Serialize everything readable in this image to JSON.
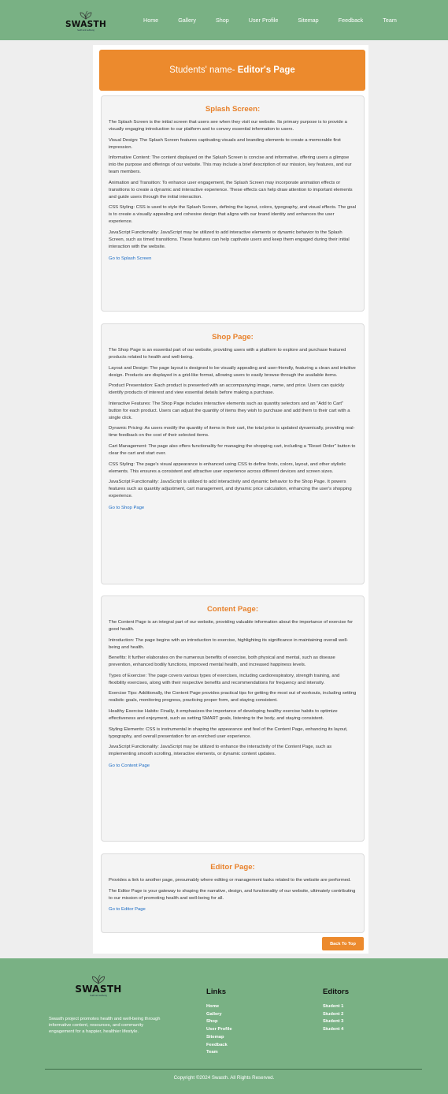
{
  "nav": {
    "logo_text": "SWASTH",
    "logo_tagline": "health and wellbeing",
    "links": [
      "Home",
      "Gallery",
      "Shop",
      "User Profile",
      "Sitemap",
      "Feedback",
      "Team"
    ]
  },
  "header": {
    "prefix": "Students' name- ",
    "title": "Editor's Page"
  },
  "sections": [
    {
      "title": "Splash Screen:",
      "paragraphs": [
        "The Splash Screen is the initial screen that users see when they visit our website. Its primary purpose is to provide a visually engaging introduction to our platform and to convey essential information to users.",
        "Visual Design: The Splash Screen features captivating visuals and branding elements to create a memorable first impression.",
        "Informative Content: The content displayed on the Splash Screen is concise and informative, offering users a glimpse into the purpose and offerings of our website. This may include a brief description of our mission, key features, and our team members.",
        "Animation and Transition: To enhance user engagement, the Splash Screen may incorporate animation effects or transitions to create a dynamic and interactive experience. These effects can help draw attention to important elements and guide users through the initial interaction.",
        "CSS Styling: CSS is used to style the Splash Screen, defining the layout, colors, typography, and visual effects. The goal is to create a visually appealing and cohesive design that aligns with our brand identity and enhances the user experience.",
        "JavaScript Functionality: JavaScript may be utilized to add interactive elements or dynamic behavior to the Splash Screen, such as timed transitions. These features can help captivate users and keep them engaged during their initial interaction with the website."
      ],
      "link": "Go to Splash Screen"
    },
    {
      "title": "Shop Page:",
      "paragraphs": [
        "The Shop Page is an essential part of our website, providing users with a platform to explore and purchase featured products related to health and well-being.",
        "Layout and Design: The page layout is designed to be visually appealing and user-friendly, featuring a clean and intuitive design. Products are displayed in a grid-like format, allowing users to easily browse through the available items.",
        "Product Presentation: Each product is presented with an accompanying image, name, and price. Users can quickly identify products of interest and view essential details before making a purchase.",
        "Interactive Features: The Shop Page includes interactive elements such as quantity selectors and an \"Add to Cart\" button for each product. Users can adjust the quantity of items they wish to purchase and add them to their cart with a single click.",
        "Dynamic Pricing: As users modify the quantity of items in their cart, the total price is updated dynamically, providing real-time feedback on the cost of their selected items.",
        "Cart Management: The page also offers functionality for managing the shopping cart, including a \"Reset Order\" button to clear the cart and start over.",
        "CSS Styling: The page's visual appearance is enhanced using CSS to define fonts, colors, layout, and other stylistic elements. This ensures a consistent and attractive user experience across different devices and screen sizes.",
        "JavaScript Functionality: JavaScript is utilized to add interactivity and dynamic behavior to the Shop Page. It powers features such as quantity adjustment, cart management, and dynamic price calculation, enhancing the user's shopping experience."
      ],
      "link": "Go to Shop Page"
    },
    {
      "title": "Content Page:",
      "paragraphs": [
        "The Content Page is an integral part of our website, providing valuable information about the importance of exercise for good health.",
        "Introduction: The page begins with an introduction to exercise, highlighting its significance in maintaining overall well-being and health.",
        "Benefits: It further elaborates on the numerous benefits of exercise, both physical and mental, such as disease prevention, enhanced bodily functions, improved mental health, and increased happiness levels.",
        "Types of Exercise: The page covers various types of exercises, including cardiorespiratory, strength training, and flexibility exercises, along with their respective benefits and recommendations for frequency and intensity.",
        "Exercise Tips: Additionally, the Content Page provides practical tips for getting the most out of workouts, including setting realistic goals, monitoring progress, practicing proper form, and staying consistent.",
        "Healthy Exercise Habits: Finally, it emphasizes the importance of developing healthy exercise habits to optimize effectiveness and enjoyment, such as setting SMART goals, listening to the body, and staying consistent.",
        "Styling Elements: CSS is instrumental in shaping the appearance and feel of the Content Page, enhancing its layout, typography, and overall presentation for an enriched user experience.",
        "JavaScript Functionality: JavaScript may be utilized to enhance the interactivity of the Content Page, such as implementing smooth scrolling, interactive elements, or dynamic content updates."
      ],
      "link": "Go to Content Page"
    },
    {
      "title": "Editor Page:",
      "paragraphs": [
        "Provides a link to another page, presumably where editing or management tasks related to the website are performed.",
        "The Editor Page is your gateway to shaping the narrative, design, and functionality of our website, ultimately contributing to our mission of promoting health and well-being for all."
      ],
      "link": "Go to Editor Page"
    }
  ],
  "back_to_top": "Back To Top",
  "footer": {
    "logo_text": "SWASTH",
    "logo_tagline": "health and wellbeing",
    "description": "Swasth project promotes health and well-being through informative content, resources, and community engagement for a happier, healthier lifestyle.",
    "links_title": "Links",
    "links": [
      "Home",
      "Gallery",
      "Shop",
      "User Profile",
      "Sitemap",
      "Feedback",
      "Team"
    ],
    "editors_title": "Editors",
    "editors": [
      "Student 1",
      "Student 2",
      "Student 3",
      "Student 4"
    ],
    "copyright": "Copyright ©2024 Swasth. All Rights Reserved."
  },
  "colors": {
    "nav_green": "#79b184",
    "accent_orange": "#ec8a2d",
    "link_blue": "#1a6bc4"
  }
}
